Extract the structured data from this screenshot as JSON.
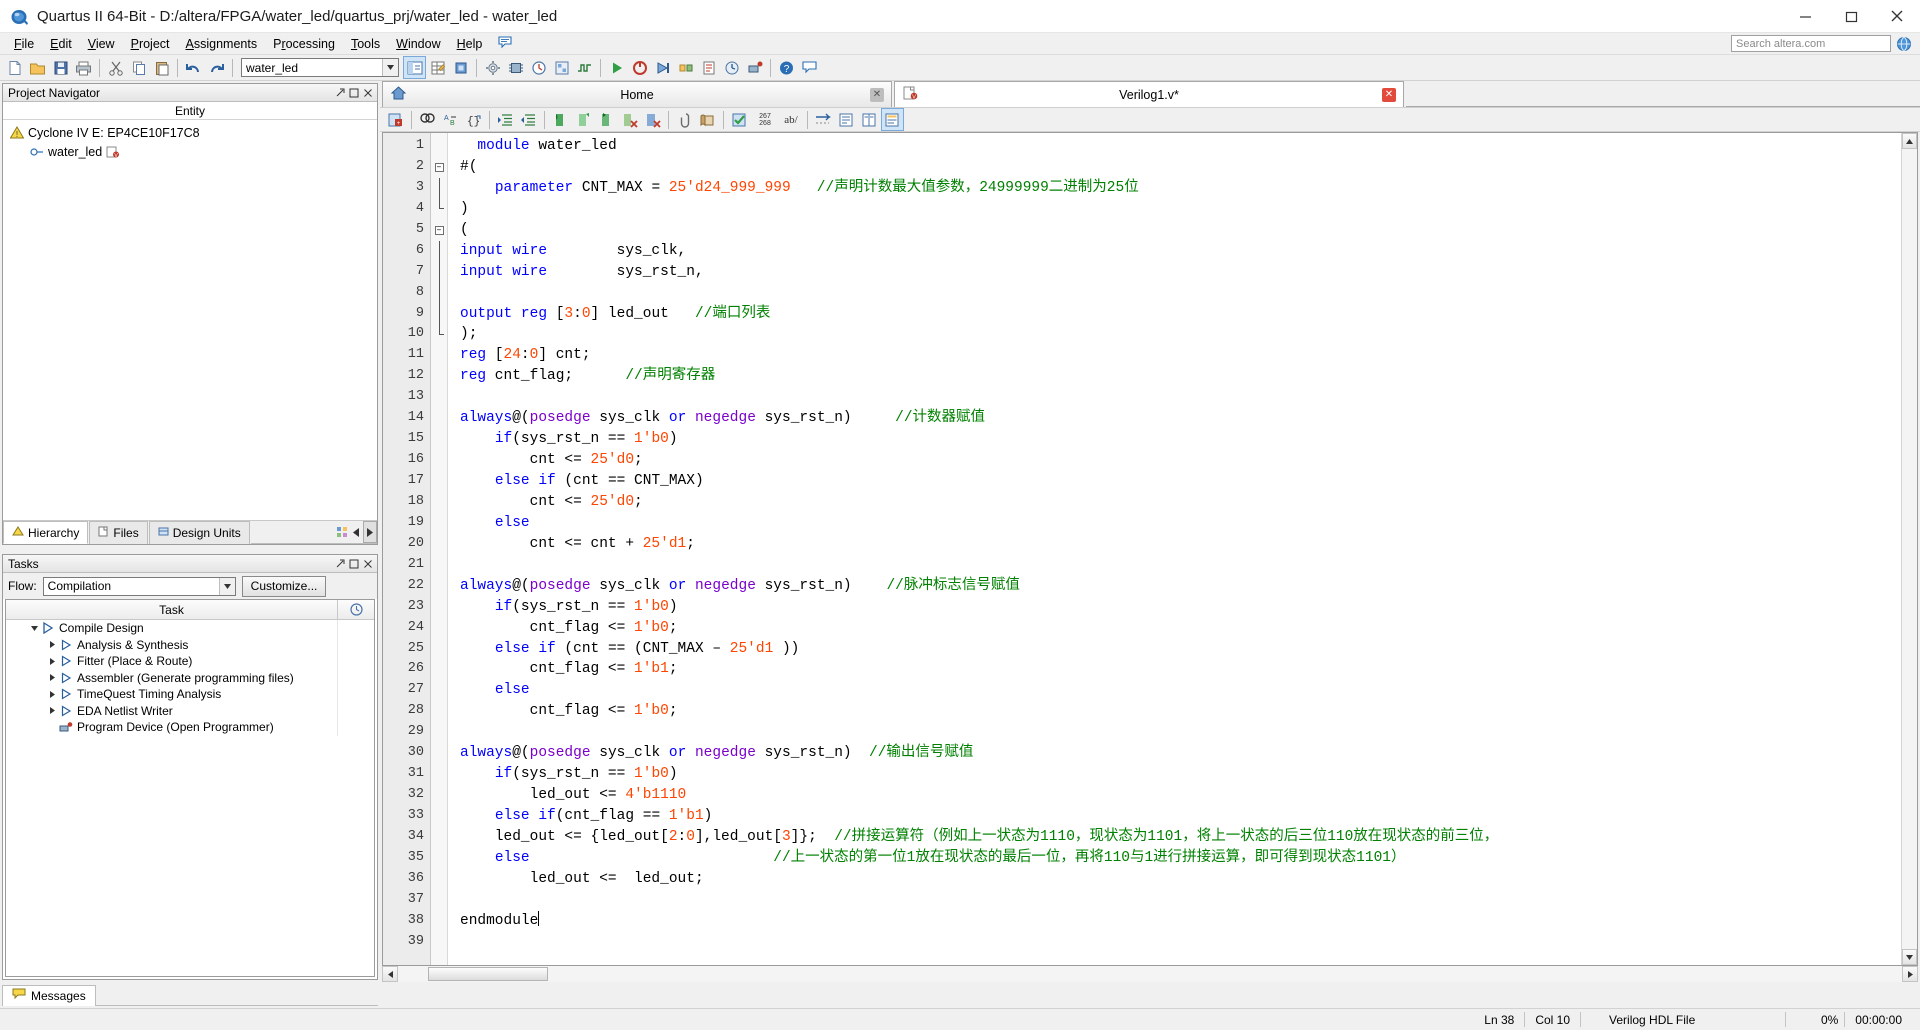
{
  "window": {
    "title": "Quartus II 64-Bit - D:/altera/FPGA/water_led/quartus_prj/water_led - water_led",
    "app_icon": "quartus-logo-icon",
    "minimize": "minimize-icon",
    "maximize": "maximize-icon",
    "close": "close-icon"
  },
  "menubar": {
    "items": [
      {
        "label": "File",
        "mnemonic": "F"
      },
      {
        "label": "Edit",
        "mnemonic": "E"
      },
      {
        "label": "View",
        "mnemonic": "V"
      },
      {
        "label": "Project",
        "mnemonic": "P"
      },
      {
        "label": "Assignments",
        "mnemonic": "A"
      },
      {
        "label": "Processing",
        "mnemonic": "P"
      },
      {
        "label": "Tools",
        "mnemonic": "T"
      },
      {
        "label": "Window",
        "mnemonic": "W"
      },
      {
        "label": "Help",
        "mnemonic": "H"
      }
    ],
    "note_icon": "note-icon",
    "search_placeholder": "Search altera.com",
    "help_icon": "help-globe-icon"
  },
  "toolbar": {
    "revision_value": "water_led",
    "dropdown_icon": "chevron-down-icon",
    "buttons": [
      "new-file-icon",
      "open-file-icon",
      "save-file-icon",
      "print-icon",
      "cut-icon",
      "copy-icon",
      "paste-icon",
      "undo-icon",
      "redo-icon"
    ],
    "buttons2": [
      "project-navigator-icon",
      "assignment-editor-icon",
      "pin-planner-icon",
      "settings-icon",
      "device-icon",
      "timing-analyzer-icon",
      "chip-planner-icon",
      "signal-tap-icon",
      "start-compilation-icon",
      "stop-icon",
      "analysis-synthesis-icon",
      "fitter-icon",
      "assembler-icon",
      "timequest-icon",
      "programmer-icon",
      "help-icon",
      "message-icon"
    ]
  },
  "project_navigator": {
    "title": "Project Navigator",
    "pin_icon": "pin-icon",
    "float_icon": "float-icon",
    "close_icon": "close-icon",
    "column_header": "Entity",
    "tree": [
      {
        "label": "Cyclone IV E: EP4CE10F17C8",
        "icon": "device-warning-icon",
        "indent": 0
      },
      {
        "label": "water_led",
        "icon": "entity-icon",
        "indent": 1,
        "badge_icon": "verilog-badge-icon"
      }
    ],
    "tabs": [
      {
        "label": "Hierarchy",
        "icon": "hierarchy-icon",
        "active": true
      },
      {
        "label": "Files",
        "icon": "files-icon",
        "active": false
      },
      {
        "label": "Design Units",
        "icon": "design-units-icon",
        "active": false
      }
    ],
    "tab_scroll_left": "scroll-left-icon",
    "tab_scroll_right": "scroll-right-icon",
    "tab_extra_icon": "ip-components-icon"
  },
  "tasks": {
    "title": "Tasks",
    "pin_icon": "pin-icon",
    "float_icon": "float-icon",
    "close_icon": "close-icon",
    "flow_label": "Flow:",
    "flow_value": "Compilation",
    "customize_label": "Customize...",
    "column_header": "Task",
    "column_header2_icon": "time-icon",
    "rows": [
      {
        "label": "Compile Design",
        "icon": "compile-design-icon",
        "indent": 0,
        "expander": "collapse",
        "expanded": true
      },
      {
        "label": "Analysis & Synthesis",
        "icon": "play-icon",
        "indent": 1,
        "expander": "expand"
      },
      {
        "label": "Fitter (Place & Route)",
        "icon": "play-icon",
        "indent": 1,
        "expander": "expand"
      },
      {
        "label": "Assembler (Generate programming files)",
        "icon": "play-icon",
        "indent": 1,
        "expander": "expand"
      },
      {
        "label": "TimeQuest Timing Analysis",
        "icon": "play-icon",
        "indent": 1,
        "expander": "expand"
      },
      {
        "label": "EDA Netlist Writer",
        "icon": "play-icon",
        "indent": 1,
        "expander": "expand"
      },
      {
        "label": "Program Device (Open Programmer)",
        "icon": "programmer-icon",
        "indent": 1,
        "expander": "none"
      }
    ]
  },
  "document_tabs": [
    {
      "label": "Home",
      "icon": "home-icon",
      "close_icon": "close-tab-icon",
      "active": false,
      "wide": true
    },
    {
      "label": "Verilog1.v*",
      "icon": "verilog-file-icon",
      "close_icon": "close-tab-icon",
      "active": true,
      "wide": true
    }
  ],
  "editor_toolbar": {
    "buttons": [
      "insert-template-icon",
      "find-icon",
      "replace-icon",
      "goto-icon",
      "increase-indent-icon",
      "decrease-indent-icon",
      "comment-icon",
      "uncomment-icon",
      "insert-file-icon",
      "remove-bookmark-icon",
      "clear-bookmarks-icon",
      "attach-icon",
      "script-icon",
      "check-syntax-icon",
      "line-numbers-icon",
      "abbrev-icon",
      "word-wrap-icon",
      "show-all-icon",
      "split-view-icon",
      "status-icon"
    ],
    "line_count_label": "267\n268"
  },
  "code": {
    "language": "Verilog",
    "cursor_line": 38,
    "cursor_col": 10,
    "total_lines": 39,
    "lines": [
      {
        "n": 1,
        "fold": "none",
        "html": "  <span class=\"kw\">module</span> water_led"
      },
      {
        "n": 2,
        "fold": "minus-start",
        "html": "#("
      },
      {
        "n": 3,
        "fold": "bar",
        "html": "    <span class=\"kw\">parameter</span> CNT_MAX = <span class=\"num\">25'd24_999_999</span>   <span class=\"cmt\">//声明计数最大值参数，24999999二进制为25位</span>"
      },
      {
        "n": 4,
        "fold": "bar-end",
        "html": ")"
      },
      {
        "n": 5,
        "fold": "minus-start",
        "html": "("
      },
      {
        "n": 6,
        "fold": "bar",
        "html": "<span class=\"kw\">input wire</span>        sys_clk,"
      },
      {
        "n": 7,
        "fold": "bar",
        "html": "<span class=\"kw\">input wire</span>        sys_rst_n,"
      },
      {
        "n": 8,
        "fold": "bar",
        "html": ""
      },
      {
        "n": 9,
        "fold": "bar",
        "html": "<span class=\"kw\">output reg</span> [<span class=\"num\">3</span>:<span class=\"num\">0</span>] led_out   <span class=\"cmt\">//端口列表</span>"
      },
      {
        "n": 10,
        "fold": "bar-end",
        "html": ");"
      },
      {
        "n": 11,
        "fold": "none",
        "html": "<span class=\"kw\">reg</span> [<span class=\"num\">24</span>:<span class=\"num\">0</span>] cnt;"
      },
      {
        "n": 12,
        "fold": "none",
        "html": "<span class=\"kw\">reg</span> cnt_flag;      <span class=\"cmt\">//声明寄存器</span>"
      },
      {
        "n": 13,
        "fold": "none",
        "html": ""
      },
      {
        "n": 14,
        "fold": "none",
        "html": "<span class=\"kw\">always</span>@(<span class=\"kw2\">posedge</span> sys_clk <span class=\"kw\">or</span> <span class=\"kw2\">negedge</span> sys_rst_n)     <span class=\"cmt\">//计数器赋值</span>"
      },
      {
        "n": 15,
        "fold": "none",
        "html": "    <span class=\"kw\">if</span>(sys_rst_n == <span class=\"num\">1'b0</span>)"
      },
      {
        "n": 16,
        "fold": "none",
        "html": "        cnt <= <span class=\"num\">25'd0</span>;"
      },
      {
        "n": 17,
        "fold": "none",
        "html": "    <span class=\"kw\">else if</span> (cnt == CNT_MAX)"
      },
      {
        "n": 18,
        "fold": "none",
        "html": "        cnt <= <span class=\"num\">25'd0</span>;"
      },
      {
        "n": 19,
        "fold": "none",
        "html": "    <span class=\"kw\">else</span>"
      },
      {
        "n": 20,
        "fold": "none",
        "html": "        cnt <= cnt + <span class=\"num\">25'd1</span>;"
      },
      {
        "n": 21,
        "fold": "none",
        "html": ""
      },
      {
        "n": 22,
        "fold": "none",
        "html": "<span class=\"kw\">always</span>@(<span class=\"kw2\">posedge</span> sys_clk <span class=\"kw\">or</span> <span class=\"kw2\">negedge</span> sys_rst_n)    <span class=\"cmt\">//脉冲标志信号赋值</span>"
      },
      {
        "n": 23,
        "fold": "none",
        "html": "    <span class=\"kw\">if</span>(sys_rst_n == <span class=\"num\">1'b0</span>)"
      },
      {
        "n": 24,
        "fold": "none",
        "html": "        cnt_flag <= <span class=\"num\">1'b0</span>;"
      },
      {
        "n": 25,
        "fold": "none",
        "html": "    <span class=\"kw\">else if</span> (cnt == (CNT_MAX – <span class=\"num\">25'd1</span> ))"
      },
      {
        "n": 26,
        "fold": "none",
        "html": "        cnt_flag <= <span class=\"num\">1'b1</span>;"
      },
      {
        "n": 27,
        "fold": "none",
        "html": "    <span class=\"kw\">else</span>"
      },
      {
        "n": 28,
        "fold": "none",
        "html": "        cnt_flag <= <span class=\"num\">1'b0</span>;"
      },
      {
        "n": 29,
        "fold": "none",
        "html": ""
      },
      {
        "n": 30,
        "fold": "none",
        "html": "<span class=\"kw\">always</span>@(<span class=\"kw2\">posedge</span> sys_clk <span class=\"kw\">or</span> <span class=\"kw2\">negedge</span> sys_rst_n)  <span class=\"cmt\">//输出信号赋值</span>"
      },
      {
        "n": 31,
        "fold": "none",
        "html": "    <span class=\"kw\">if</span>(sys_rst_n == <span class=\"num\">1'b0</span>)"
      },
      {
        "n": 32,
        "fold": "none",
        "html": "        led_out <= <span class=\"num\">4'b1110</span>"
      },
      {
        "n": 33,
        "fold": "none",
        "html": "    <span class=\"kw\">else if</span>(cnt_flag == <span class=\"num\">1'b1</span>)"
      },
      {
        "n": 34,
        "fold": "none",
        "html": "    led_out <= {led_out[<span class=\"num\">2</span>:<span class=\"num\">0</span>],led_out[<span class=\"num\">3</span>]};  <span class=\"cmt\">//拼接运算符（例如上一状态为1110，现状态为1101，将上一状态的后三位110放在现状态的前三位，</span>"
      },
      {
        "n": 35,
        "fold": "none",
        "html": "    <span class=\"kw\">else</span>                            <span class=\"cmt\">//上一状态的第一位1放在现状态的最后一位，再将110与1进行拼接运算，即可得到现状态1101）</span>"
      },
      {
        "n": 36,
        "fold": "none",
        "html": "        led_out <=  led_out;"
      },
      {
        "n": 37,
        "fold": "none",
        "html": ""
      },
      {
        "n": 38,
        "fold": "none",
        "html": "endmodule<span class=\"caret\"></span>"
      },
      {
        "n": 39,
        "fold": "none",
        "html": ""
      }
    ]
  },
  "messages": {
    "label": "Messages",
    "icon": "messages-icon"
  },
  "statusbar": {
    "line_label": "Ln 38",
    "col_label": "Col 10",
    "filetype_label": "Verilog HDL File",
    "progress_label": "0%",
    "time_label": "00:00:00"
  },
  "colors": {
    "keyword": "#0000ff",
    "keyword_alt": "#7a00cc",
    "number": "#ff4500",
    "comment": "#008000",
    "accent": "#e24a3b",
    "chrome": "#f0f0f0"
  }
}
